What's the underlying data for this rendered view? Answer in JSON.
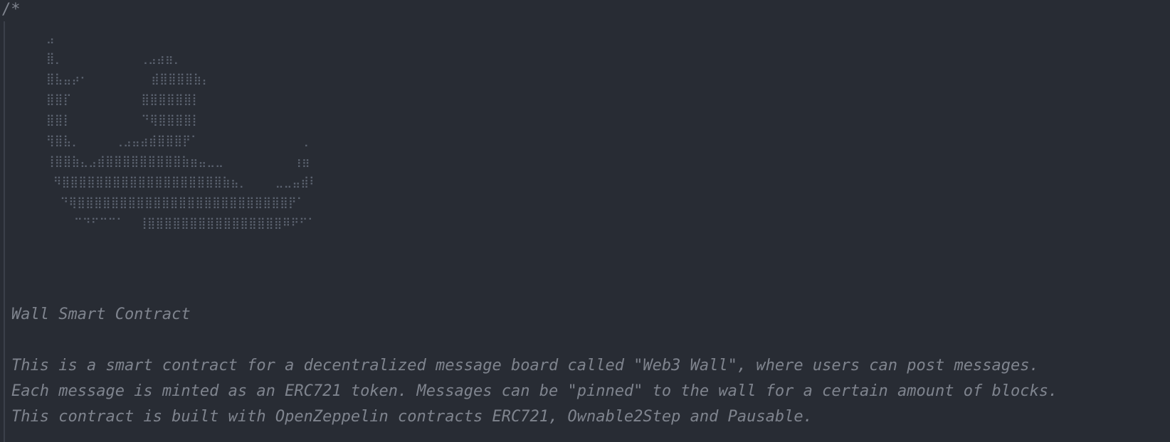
{
  "editor": {
    "comment_open": "/*",
    "ascii_art": [
      "     ⣠",
      "     ⣿⡀           ⢀⣠⣴⣶⡀",
      "     ⣿⣧⣤⡴⠂         ⣾⣿⣿⣿⣿⣷⡄",
      "     ⣿⣿⡏          ⣿⣿⣿⣿⣿⣿⡇",
      "     ⣿⣿⡇          ⠙⢿⣿⣿⣿⣿⡇",
      "     ⢻⣿⣧⡀     ⢀⣠⣤⣴⣾⣿⣿⣿⡟⠁               ⡀",
      "     ⢸⣿⣿⣷⣄⣠⣾⣿⣿⣿⣿⣿⣿⣿⣿⣿⣷⣶⣤⣀⣀          ⢰⣶",
      "      ⠻⣿⣿⣿⣿⣿⣿⣿⣿⣿⣿⣿⣿⣿⣿⣿⣿⣿⣿⣿⣷⣦⡀    ⣀⣀⣤⣾⠇",
      "       ⠙⢿⣿⣿⣿⣿⣿⣿⣿⣿⣿⣿⣿⣿⣿⣿⣿⣿⣿⣿⣿⣿⣿⣿⣿⣿⣿⡟⠁",
      "         ⠉⠙⠋⠉⠉⠁  ⢸⣿⣿⣿⣿⣿⣿⣿⣿⣿⣿⣿⣿⣿⣿⣿⣿⠿⠟⠋⠁"
    ],
    "title": "Wall Smart Contract",
    "description_lines": [
      "This is a smart contract for a decentralized message board called \"Web3 Wall\", where users can post messages.",
      "Each message is minted as an ERC721 token. Messages can be \"pinned\" to the wall for a certain amount of blocks.",
      "This contract is built with OpenZeppelin contracts ERC721, Ownable2Step and Pausable."
    ]
  }
}
